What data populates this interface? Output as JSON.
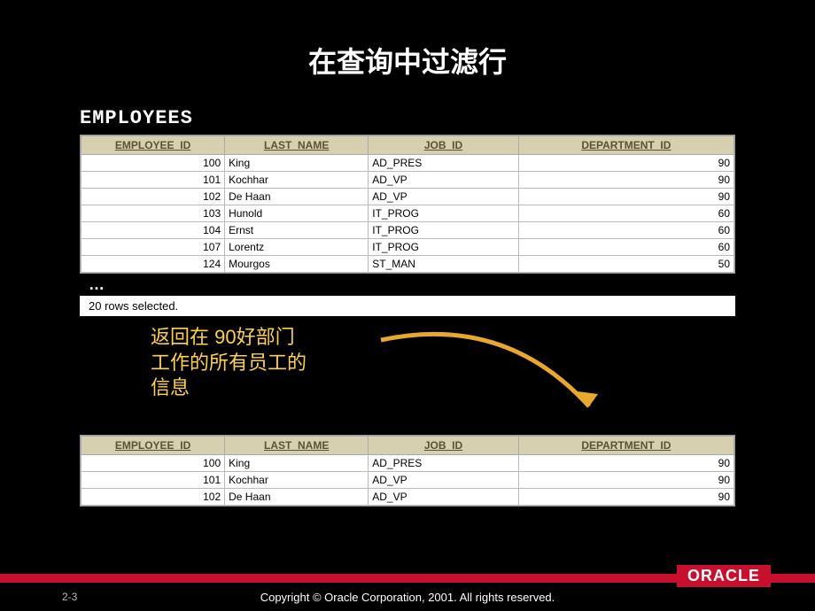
{
  "slide": {
    "title": "在查询中过滤行",
    "page_num": "2-3",
    "copyright": "Copyright © Oracle Corporation, 2001. All rights reserved.",
    "logo": "ORACLE"
  },
  "table1": {
    "label": "EMPLOYEES",
    "headers": {
      "c0": "EMPLOYEE_ID",
      "c1": "LAST_NAME",
      "c2": "JOB_ID",
      "c3": "DEPARTMENT_ID"
    },
    "rows": [
      {
        "c0": "100",
        "c1": "King",
        "c2": "AD_PRES",
        "c3": "90"
      },
      {
        "c0": "101",
        "c1": "Kochhar",
        "c2": "AD_VP",
        "c3": "90"
      },
      {
        "c0": "102",
        "c1": "De Haan",
        "c2": "AD_VP",
        "c3": "90"
      },
      {
        "c0": "103",
        "c1": "Hunold",
        "c2": "IT_PROG",
        "c3": "60"
      },
      {
        "c0": "104",
        "c1": "Ernst",
        "c2": "IT_PROG",
        "c3": "60"
      },
      {
        "c0": "107",
        "c1": "Lorentz",
        "c2": "IT_PROG",
        "c3": "60"
      },
      {
        "c0": "124",
        "c1": "Mourgos",
        "c2": "ST_MAN",
        "c3": "50"
      }
    ],
    "ellipsis": "…",
    "status": "20 rows selected."
  },
  "note": {
    "text": "返回在 90好部门工作的所有员工的信息"
  },
  "table2": {
    "headers": {
      "c0": "EMPLOYEE_ID",
      "c1": "LAST_NAME",
      "c2": "JOB_ID",
      "c3": "DEPARTMENT_ID"
    },
    "rows": [
      {
        "c0": "100",
        "c1": "King",
        "c2": "AD_PRES",
        "c3": "90"
      },
      {
        "c0": "101",
        "c1": "Kochhar",
        "c2": "AD_VP",
        "c3": "90"
      },
      {
        "c0": "102",
        "c1": "De Haan",
        "c2": "AD_VP",
        "c3": "90"
      }
    ]
  }
}
